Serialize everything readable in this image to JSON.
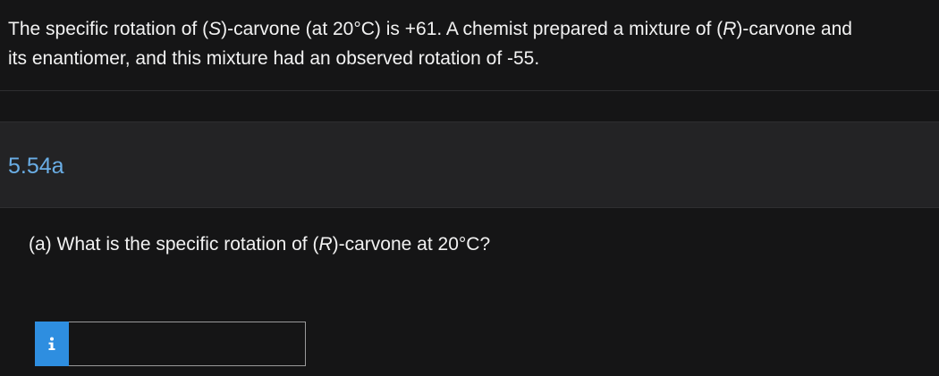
{
  "problem": {
    "line1_a": "The specific rotation of (",
    "line1_s": "S",
    "line1_b": ")-carvone (at 20°C) is +61. A chemist prepared a mixture of (",
    "line1_r": "R",
    "line1_c": ")-carvone and",
    "line2": "its enantiomer, and this mixture had an observed rotation of -55."
  },
  "part": {
    "label": "5.54a"
  },
  "question": {
    "text_a": "(a) What is the specific rotation of (",
    "text_r": "R",
    "text_b": ")-carvone at 20°C?"
  },
  "answer": {
    "info_icon": "info-icon",
    "value": "",
    "placeholder": "",
    "info_color": "#2e8ee0"
  }
}
